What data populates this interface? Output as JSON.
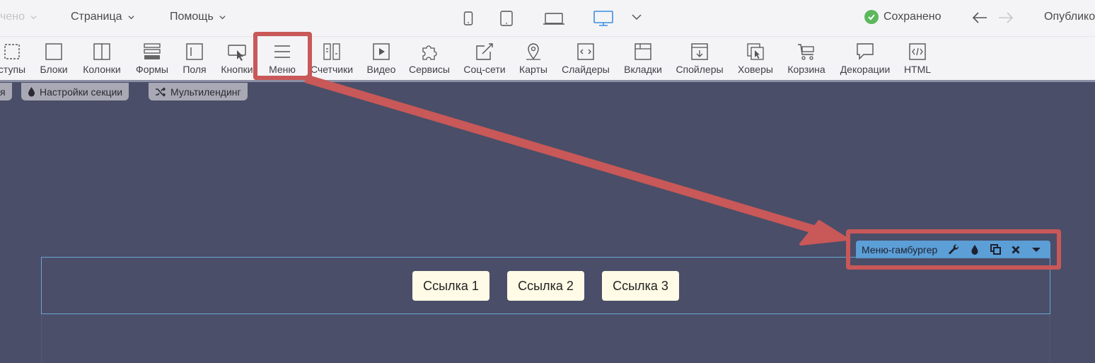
{
  "topbar": {
    "menus": [
      {
        "label": "чено",
        "faded": true
      },
      {
        "label": "Страница"
      },
      {
        "label": "Помощь"
      }
    ],
    "devices": [
      "phone",
      "tablet",
      "laptop",
      "desktop"
    ],
    "active_device": "desktop",
    "saved_label": "Сохранено",
    "publish_label": "Опублико"
  },
  "toolbar": {
    "items": [
      {
        "label": "ступы",
        "icon": "indent-icon"
      },
      {
        "label": "Блоки",
        "icon": "square-icon"
      },
      {
        "label": "Колонки",
        "icon": "columns-icon"
      },
      {
        "label": "Формы",
        "icon": "form-icon"
      },
      {
        "label": "Поля",
        "icon": "field-icon"
      },
      {
        "label": "Кнопки",
        "icon": "button-cursor-icon"
      },
      {
        "label": "Меню",
        "icon": "hamburger-icon",
        "highlighted": true
      },
      {
        "label": "Счетчики",
        "icon": "counter-icon"
      },
      {
        "label": "Видео",
        "icon": "play-icon"
      },
      {
        "label": "Сервисы",
        "icon": "puzzle-icon"
      },
      {
        "label": "Соц-сети",
        "icon": "share-icon"
      },
      {
        "label": "Карты",
        "icon": "map-pin-icon"
      },
      {
        "label": "Слайдеры",
        "icon": "slider-icon"
      },
      {
        "label": "Вкладки",
        "icon": "tabs-icon"
      },
      {
        "label": "Спойлеры",
        "icon": "spoiler-icon"
      },
      {
        "label": "Ховеры",
        "icon": "hover-icon"
      },
      {
        "label": "Корзина",
        "icon": "cart-icon"
      },
      {
        "label": "Декорации",
        "icon": "speech-bubble-icon"
      },
      {
        "label": "HTML",
        "icon": "code-icon"
      }
    ]
  },
  "section": {
    "chips": [
      {
        "label": "я"
      },
      {
        "label": "Настройки секции",
        "icon": "drop-icon"
      },
      {
        "label": "Мультилендинг",
        "icon": "shuffle-icon"
      }
    ]
  },
  "canvas": {
    "links": [
      "Ссылка 1",
      "Ссылка 2",
      "Ссылка 3"
    ],
    "widget": {
      "title": "Меню-гамбургер",
      "actions": [
        "wrench-icon",
        "drop-icon",
        "duplicate-icon",
        "close-icon",
        "caret-down-icon"
      ]
    }
  },
  "colors": {
    "canvas_bg": "#4a4e68",
    "toolbar_bg": "#f4f4f6",
    "annotation": "#c95858",
    "widget_bar": "#5c9ed6",
    "link_button_bg": "#fffbe6",
    "active_device": "#3b8ee0",
    "saved_check": "#5cb85c"
  }
}
